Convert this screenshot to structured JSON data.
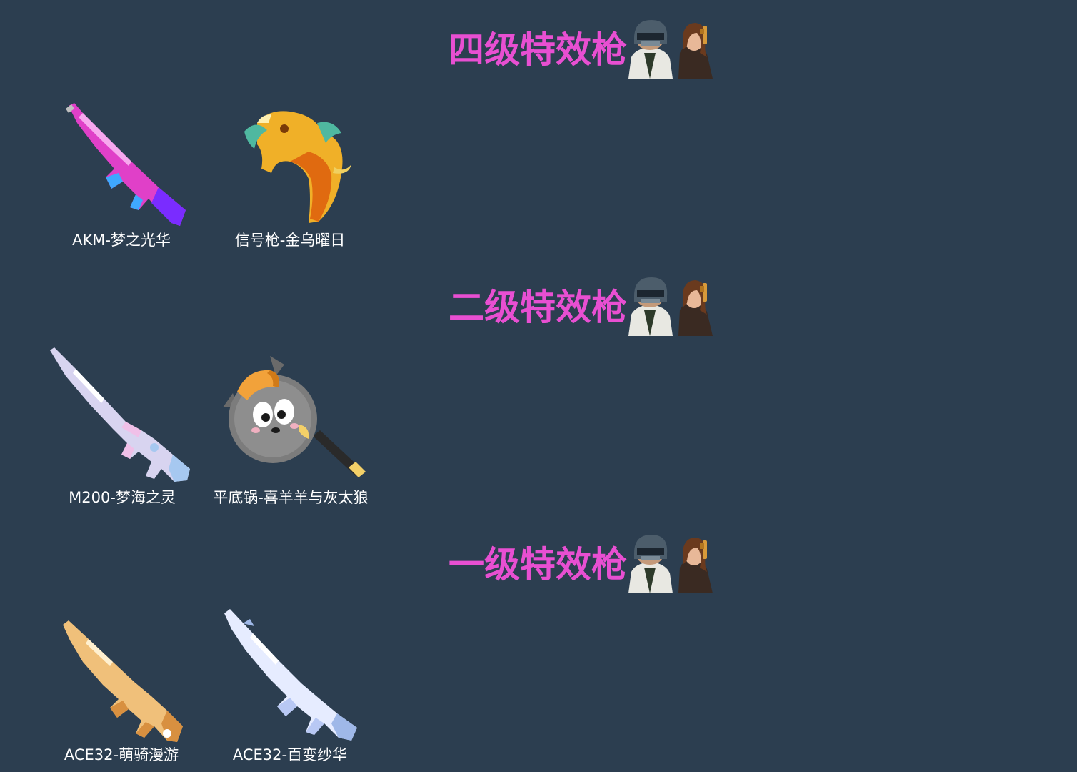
{
  "sections": [
    {
      "heading": "四级特效枪",
      "items": [
        {
          "label": "AKM-梦之光华",
          "icon": "akm-rifle-pink-skin-icon",
          "colors": [
            "#e040c8",
            "#7a2cff",
            "#3fa8ff"
          ]
        },
        {
          "label": "信号枪-金乌曜日",
          "icon": "flare-gun-golden-bird-skin-icon",
          "colors": [
            "#f0b028",
            "#e06a10",
            "#4fb8a0"
          ]
        }
      ]
    },
    {
      "heading": "二级特效枪",
      "items": [
        {
          "label": "M200-梦海之灵",
          "icon": "m200-sniper-pearl-skin-icon",
          "colors": [
            "#d8d4f0",
            "#a6c8f0",
            "#f0c0e8"
          ]
        },
        {
          "label": "平底锅-喜羊羊与灰太狼",
          "icon": "frying-pan-grey-wolf-skin-icon",
          "colors": [
            "#7c7c7c",
            "#f2a23a",
            "#f4d068"
          ]
        }
      ]
    },
    {
      "heading": "一级特效枪",
      "items": [
        {
          "label": "ACE32-萌骑漫游",
          "icon": "ace32-rifle-gold-skin-icon",
          "colors": [
            "#f0c07a",
            "#d89040",
            "#fff0d0"
          ]
        },
        {
          "label": "ACE32-百变纱华",
          "icon": "ace32-rifle-crystal-skin-icon",
          "colors": [
            "#e6ecff",
            "#b8c8f4",
            "#9fb8e8"
          ]
        }
      ]
    }
  ],
  "heading_icon": "pubg-characters-icon",
  "accent_color": "#e84fd2",
  "background_color": "#2c3e50"
}
